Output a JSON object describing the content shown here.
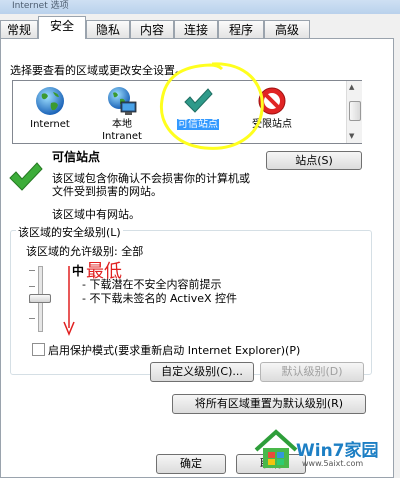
{
  "window": {
    "title": "Internet 选项"
  },
  "tabs": [
    "常规",
    "安全",
    "隐私",
    "内容",
    "连接",
    "程序",
    "高级"
  ],
  "active_tab": "安全",
  "instruction": "选择要查看的区域或更改安全设置。",
  "zones": [
    {
      "icon": "globe-icon",
      "label": "Internet"
    },
    {
      "icon": "intranet-icon",
      "label": "本地",
      "label2": "Intranet"
    },
    {
      "icon": "checkmark-icon",
      "label": "可信站点",
      "selected": true
    },
    {
      "icon": "restricted-icon",
      "label": "受限站点"
    }
  ],
  "zone_info": {
    "title": "可信站点",
    "desc1": "该区域包含你确认不会损害你的计算机或",
    "desc2": "文件受到损害的网站。",
    "has_sites": "该区域中有网站。",
    "sites_button": "站点(S)"
  },
  "security": {
    "group_label": "该区域的安全级别(L)",
    "allowed": "该区域的允许级别: 全部",
    "level": "中",
    "annotation": "最低",
    "bullet1": "- 下载潜在不安全内容前提示",
    "bullet2": "- 不下载未签名的 ActiveX 控件",
    "protected_mode": "启用保护模式(要求重新启动 Internet Explorer)(P)",
    "protected_checked": false,
    "custom_button": "自定义级别(C)...",
    "default_button": "默认级别(D)"
  },
  "reset_button": "将所有区域重置为默认级别(R)",
  "ok_button": "确定",
  "cancel_button": "取消",
  "watermark": {
    "brand": "Win7家园",
    "url": "www.5aixt.com"
  },
  "colors": {
    "highlight": "#ffff1e",
    "annotation": "#e02020",
    "selection": "#3399ff"
  }
}
